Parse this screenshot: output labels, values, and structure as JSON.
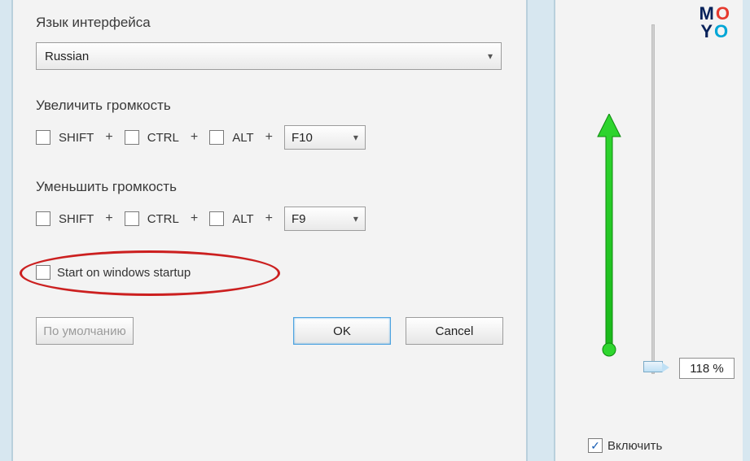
{
  "labels": {
    "language": "Язык интерфейса",
    "increase": "Увеличить громкость",
    "decrease": "Уменьшить громкость",
    "startup": "Start on windows startup",
    "default_btn": "По умолчанию",
    "ok_btn": "OK",
    "cancel_btn": "Cancel",
    "enable": "Включить"
  },
  "language_value": "Russian",
  "mods": {
    "shift": "SHIFT",
    "ctrl": "CTRL",
    "alt": "ALT"
  },
  "increase_key": "F10",
  "decrease_key": "F9",
  "volume_percent": "118 %",
  "logo": {
    "m": "M",
    "o1": "O",
    "y": "Y",
    "o2": "O"
  }
}
